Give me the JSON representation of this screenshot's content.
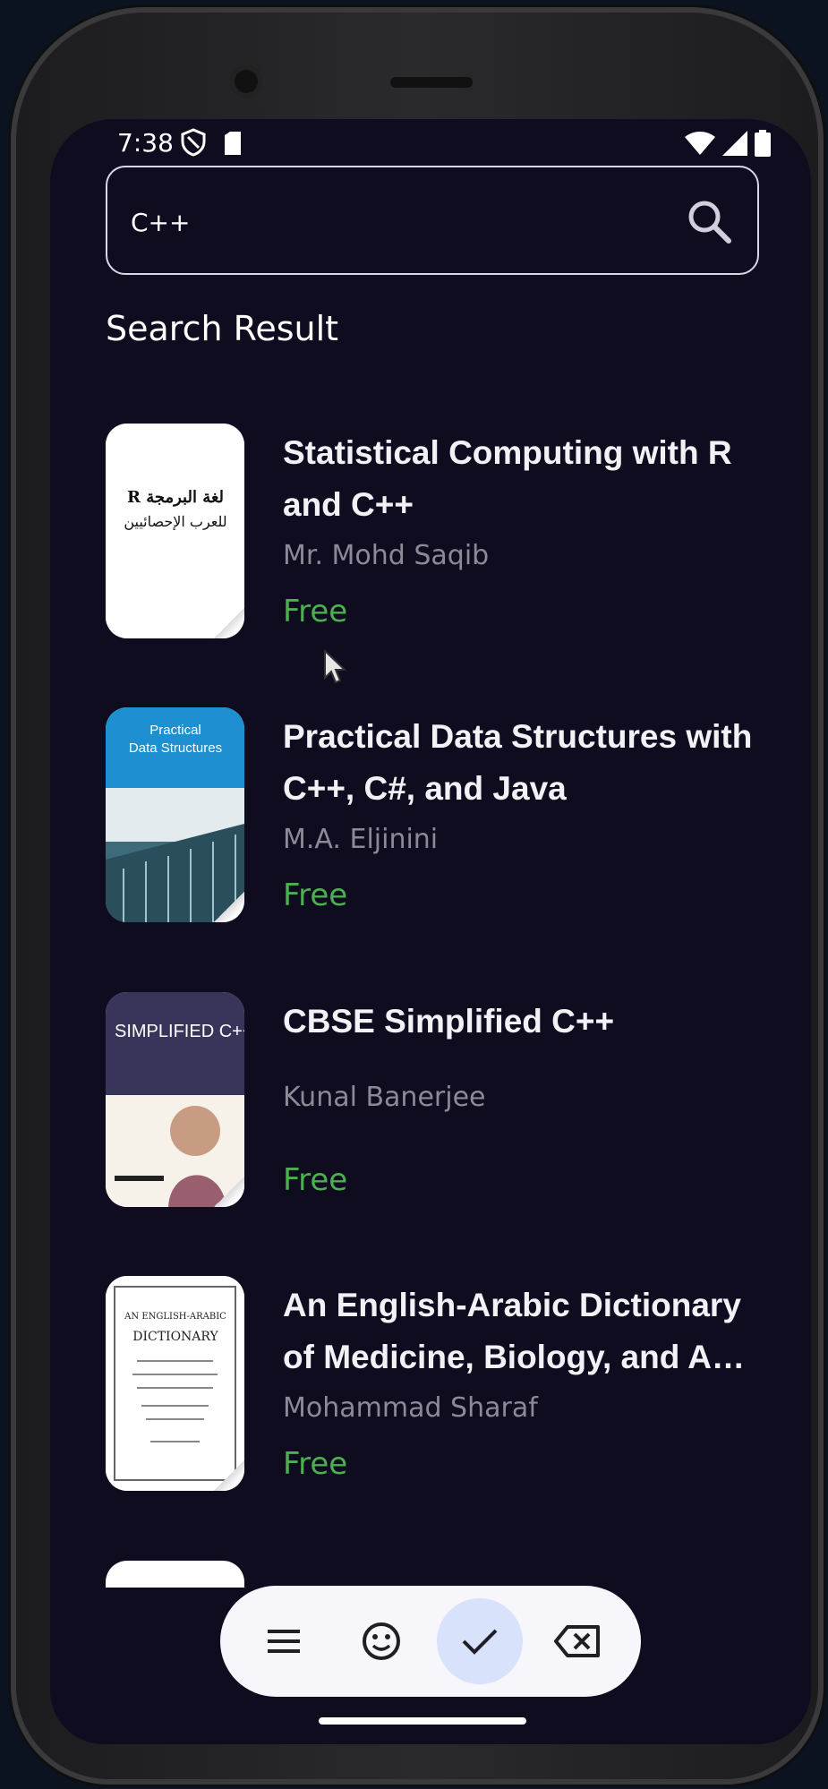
{
  "status_bar": {
    "time": "7:38",
    "icons": [
      "shield-icon",
      "sim-card-icon",
      "wifi-icon",
      "signal-icon",
      "battery-icon"
    ]
  },
  "search": {
    "value": "C++",
    "placeholder": "",
    "icon": "search-icon"
  },
  "results": {
    "title": "Search Result",
    "books": [
      {
        "title": "Statistical Computing with R and C++",
        "author": "Mr. Mohd Saqib",
        "price": "Free",
        "cover_lettering": "لغة البرمجة R للعرب الإحصائيين"
      },
      {
        "title": "Practical Data Structures with C++, C#, and Java",
        "author": "M.A. Eljinini",
        "price": "Free",
        "cover_lettering": "Practical Data Structures"
      },
      {
        "title": "CBSE Simplified C++",
        "author": "Kunal Banerjee",
        "price": "Free",
        "cover_lettering": "SIMPLIFIED C++"
      },
      {
        "title": "An English-Arabic Dictionary of Medicine, Biology, and A…",
        "author": "Mohammad Sharaf",
        "price": "Free",
        "cover_lettering": "AN ENGLISH-ARABIC DICTIONARY"
      }
    ]
  },
  "keyboard_toolbar": {
    "buttons": [
      "menu-icon",
      "emoji-icon",
      "check-icon",
      "backspace-icon"
    ],
    "active": "check-icon",
    "active_color": "#d9e2fb"
  },
  "colors": {
    "background": "#0e0c1e",
    "price": "#4caf50",
    "author": "#8b8a97",
    "text": "#f2f2f6"
  }
}
